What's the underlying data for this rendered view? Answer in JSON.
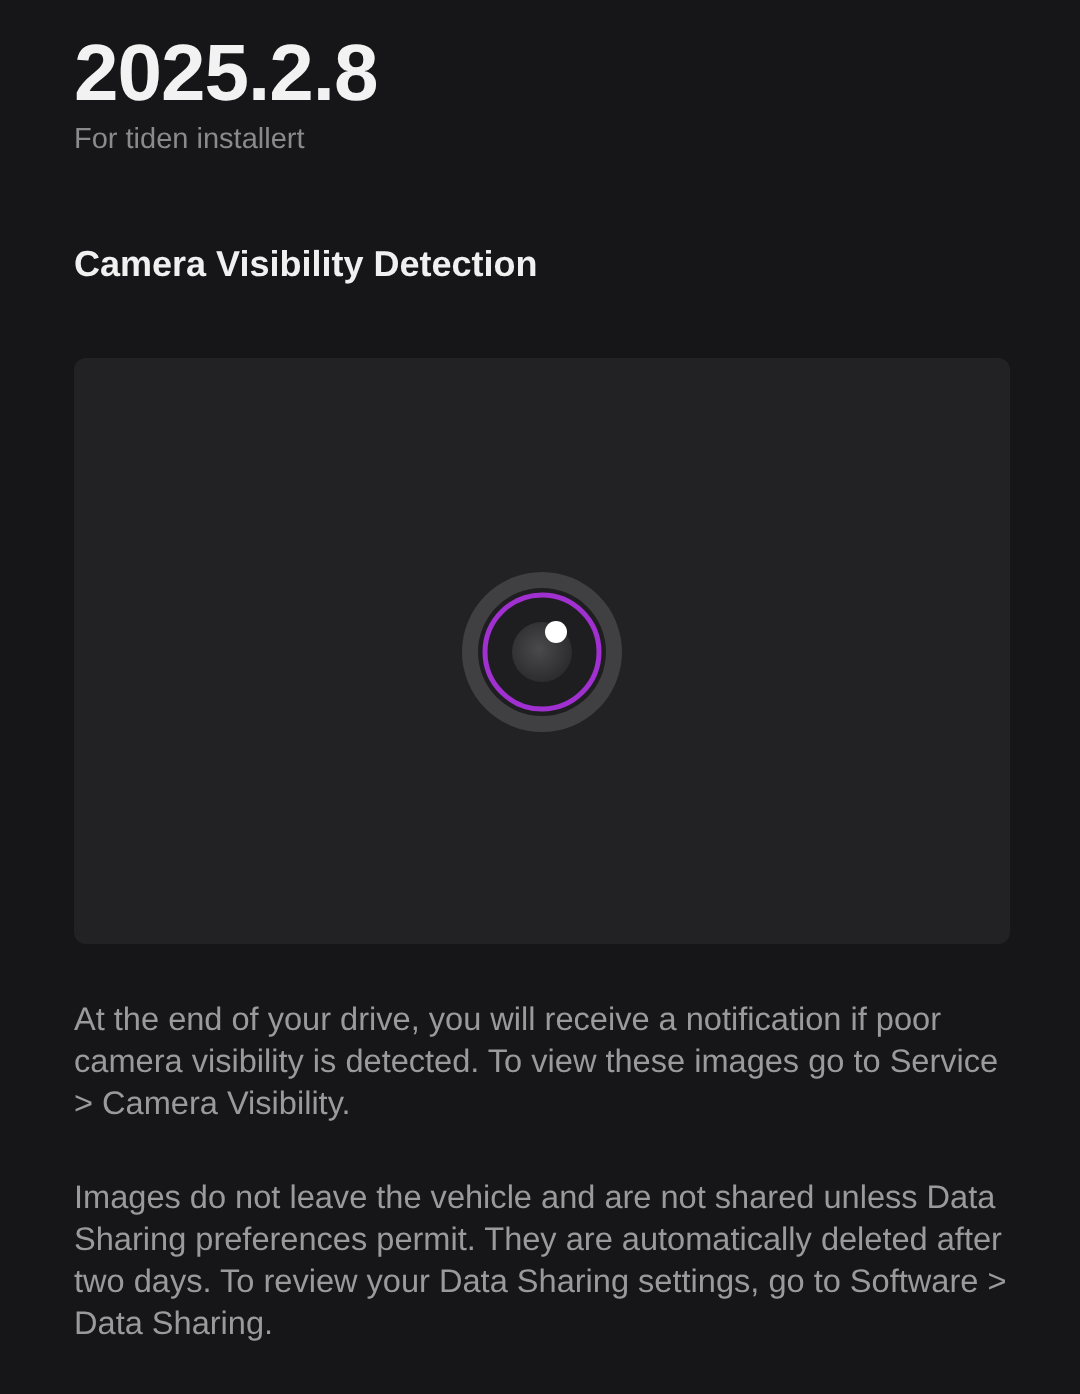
{
  "version": {
    "number": "2025.2.8",
    "status": "For tiden installert"
  },
  "section": {
    "title": "Camera Visibility Detection"
  },
  "paragraphs": [
    "At the end of your drive, you will receive a notification if poor camera visibility is detected. To view these images go to Service > Camera Visibility.",
    "Images do not leave the vehicle and are not shared unless Data Sharing preferences permit. They are automatically deleted after two days. To review your Data Sharing settings, go to Software > Data Sharing."
  ]
}
